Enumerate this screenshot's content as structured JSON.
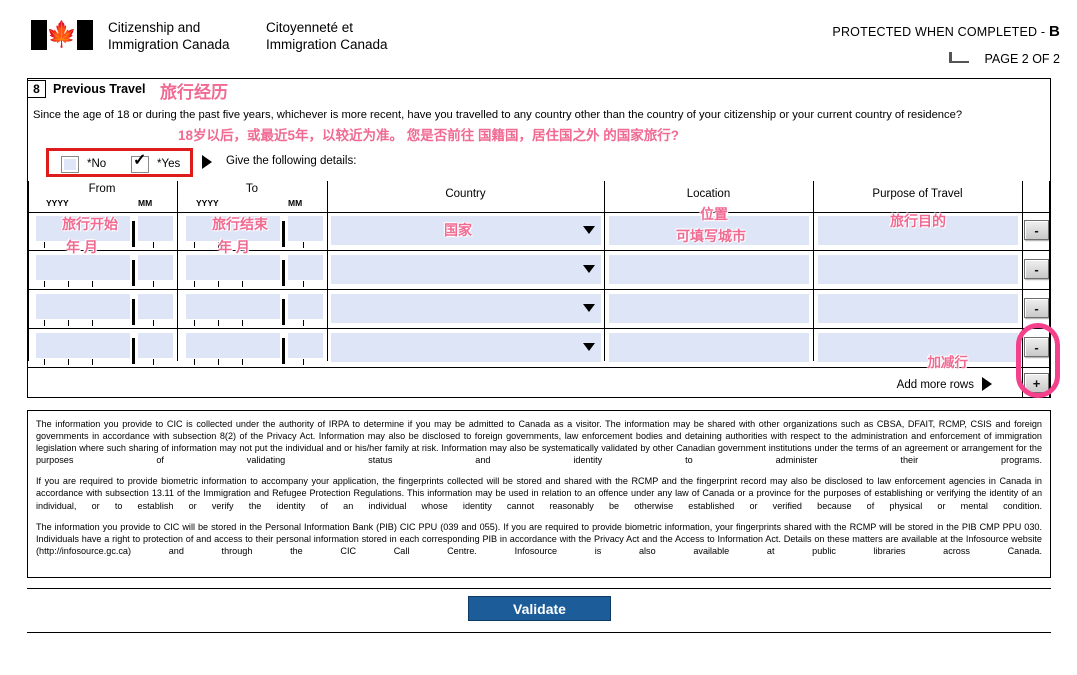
{
  "header": {
    "dept_en_line1": "Citizenship and",
    "dept_en_line2": "Immigration Canada",
    "dept_fr_line1": "Citoyenneté et",
    "dept_fr_line2": "Immigration Canada",
    "protected_text": "PROTECTED WHEN COMPLETED - ",
    "protected_class": "B",
    "page_number": "PAGE 2 OF 2",
    "flag_leaf": "🍁"
  },
  "section": {
    "number": "8",
    "title": "Previous Travel",
    "title_cn": "旅行经历",
    "question": "Since the age of 18 or during the past five years, whichever is more recent, have you travelled to any country other than the country of your citizenship or your current country of residence?",
    "question_cn": "18岁以后，或最近5年，以较近为准。 您是否前往 国籍国，居住国之外 的国家旅行?"
  },
  "choice": {
    "no_label": "*No",
    "yes_label": "*Yes",
    "yes_checked": true,
    "no_checked": false,
    "check_glyph": "✓",
    "give_details": "Give the following details:"
  },
  "table": {
    "columns": [
      {
        "label": "From",
        "sub_left": "YYYY",
        "sub_right": "MM"
      },
      {
        "label": "To",
        "sub_left": "YYYY",
        "sub_right": "MM"
      },
      {
        "label": "Country",
        "sub_left": "",
        "sub_right": ""
      },
      {
        "label": "Location",
        "sub_left": "",
        "sub_right": ""
      },
      {
        "label": "Purpose of Travel",
        "sub_left": "",
        "sub_right": ""
      }
    ],
    "annotations": {
      "from_cn": "旅行开始",
      "from_cn2": "年 月",
      "to_cn": "旅行结束",
      "to_cn2": "年 月",
      "country_cn": "国家",
      "location_cn": "位置",
      "location_cn2": "可填写城市",
      "purpose_cn": "旅行目的",
      "addrow_cn": "加减行"
    },
    "rows": [
      {
        "from_yyyy": "",
        "from_mm": "",
        "to_yyyy": "",
        "to_mm": "",
        "country": "",
        "location": "",
        "purpose": "",
        "remove_label": "-"
      },
      {
        "from_yyyy": "",
        "from_mm": "",
        "to_yyyy": "",
        "to_mm": "",
        "country": "",
        "location": "",
        "purpose": "",
        "remove_label": "-"
      },
      {
        "from_yyyy": "",
        "from_mm": "",
        "to_yyyy": "",
        "to_mm": "",
        "country": "",
        "location": "",
        "purpose": "",
        "remove_label": "-"
      },
      {
        "from_yyyy": "",
        "from_mm": "",
        "to_yyyy": "",
        "to_mm": "",
        "country": "",
        "location": "",
        "purpose": "",
        "remove_label": "-"
      }
    ],
    "add_more_rows_label": "Add more rows",
    "add_button_label": "+"
  },
  "legal": {
    "p1": "The information you provide to CIC is collected under the authority of IRPA to determine if you may be admitted to Canada as a visitor. The information may be shared with other organizations such as CBSA, DFAIT, RCMP, CSIS and foreign governments in accordance with subsection 8(2) of the Privacy Act. Information may also be disclosed to foreign governments, law enforcement bodies and detaining authorities with respect to the administration and enforcement of immigration legislation where such sharing of information may not put the individual and or his/her family at risk. Information may also be systematically validated by other Canadian government institutions under the terms of an agreement or arrangement for the purposes of validating status and identity to administer their programs.",
    "p2": "If you are required to provide biometric information to accompany your application, the fingerprints collected will be stored and shared with the RCMP and the fingerprint record may also be disclosed to law enforcement agencies in Canada in accordance with subsection 13.11 of the Immigration and Refugee Protection Regulations. This information may be used in relation to an offence under any law of Canada or a province for the purposes of establishing or verifying the identity of an individual, or to establish or verify the identity of an individual whose identity cannot reasonably be otherwise established or verified because of physical or mental condition.",
    "p3": "The information you provide to CIC will be stored in the Personal Information Bank (PIB) CIC PPU (039 and 055). If you are required to provide biometric information, your fingerprints shared with the RCMP will be stored in the PIB CMP PPU 030. Individuals have a right to protection of and access to their personal information stored in each corresponding PIB in accordance with the Privacy Act and the Access to Information Act. Details on these matters are available at the Infosource website (http://infosource.gc.ca) and through the CIC Call Centre. Infosource is also available at public libraries across Canada."
  },
  "footer": {
    "validate_label": "Validate"
  },
  "colors": {
    "field_fill": "#dde5f7",
    "annotation_pink": "#f06a92",
    "highlight_red": "#e01b1b",
    "highlight_pink": "#f5408c",
    "validate_blue": "#1c5d99"
  }
}
